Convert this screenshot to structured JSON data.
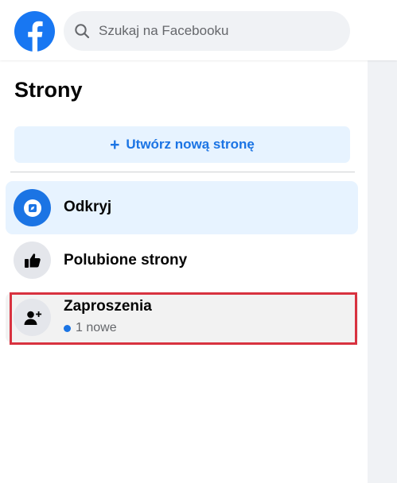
{
  "topbar": {
    "logo_icon": "facebook-logo-icon",
    "search": {
      "placeholder": "Szukaj na Facebooku",
      "value": "",
      "icon": "search-icon"
    }
  },
  "sidebar": {
    "title": "Strony",
    "create_button": {
      "plus": "+",
      "label": "Utwórz nową stronę"
    },
    "items": [
      {
        "label": "Odkryj",
        "icon": "discover-pages-icon",
        "active": true
      },
      {
        "label": "Polubione strony",
        "icon": "thumbs-up-icon",
        "active": false
      },
      {
        "label": "Zaproszenia",
        "icon": "add-person-icon",
        "badge": "1 nowe",
        "highlighted": true
      }
    ]
  },
  "colors": {
    "accent": "#1b74e4",
    "active_bg": "#e7f3ff",
    "highlight_border": "#d8323f",
    "secondary_text": "#65676b"
  }
}
